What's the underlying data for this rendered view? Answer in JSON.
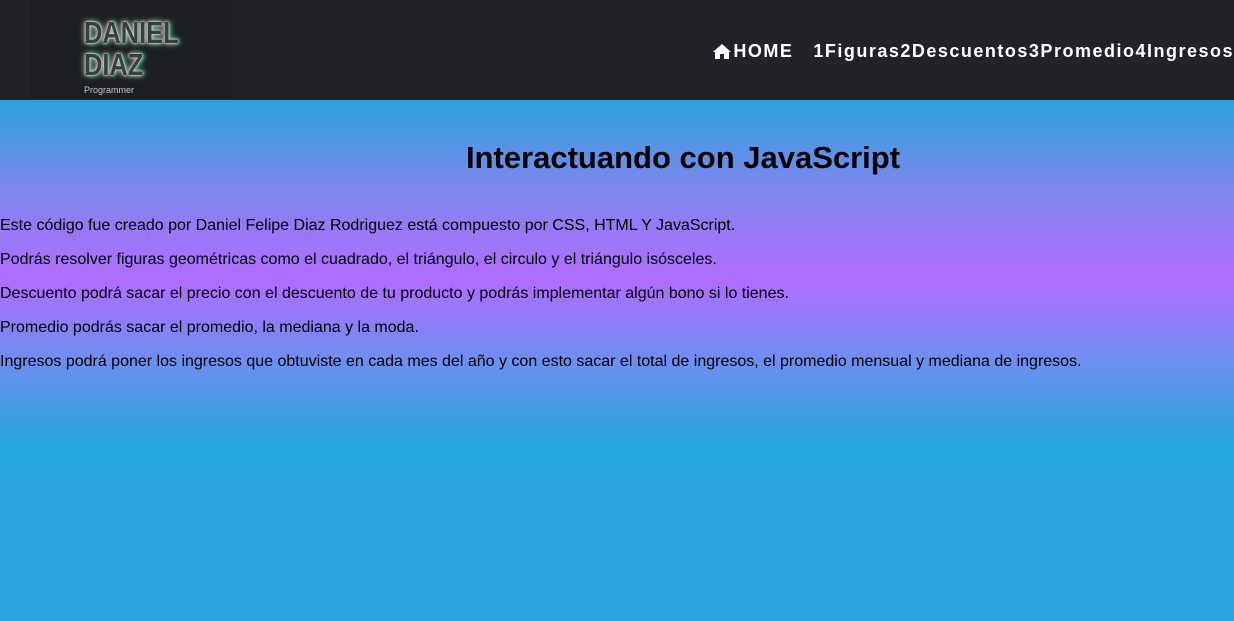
{
  "brand": {
    "logo_line1": "DANIEL",
    "logo_line2": "DIAZ",
    "logo_subtitle": "Programmer"
  },
  "nav": {
    "home_icon": "home-icon",
    "items": [
      {
        "label": "HOME"
      },
      {
        "label": "1Figuras"
      },
      {
        "label": "2Descuentos"
      },
      {
        "label": "3Promedio"
      },
      {
        "label": "4Ingresos"
      }
    ]
  },
  "main": {
    "title": "Interactuando con JavaScript",
    "paragraphs": [
      "Este código fue creado por Daniel Felipe Diaz Rodriguez está compuesto por CSS, HTML Y JavaScript.",
      "Podrás resolver figuras geométricas como el cuadrado, el triángulo, el circulo y el triángulo isósceles.",
      "Descuento podrá sacar el precio con el descuento de tu producto y podrás implementar algún bono si lo tienes.",
      "Promedio podrás sacar el promedio, la mediana y la moda.",
      "Ingresos podrá poner los ingresos que obtuviste en cada mes del año y con esto sacar el total de ingresos, el promedio mensual y mediana de ingresos."
    ]
  },
  "colors": {
    "navbar_bg": "#212328",
    "nav_text": "#ffffff",
    "gradient_blue": "#22a6dc",
    "gradient_purple": "#b06cff"
  }
}
